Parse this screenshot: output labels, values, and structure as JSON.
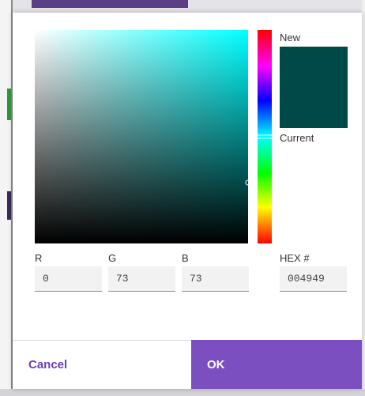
{
  "colors": {
    "selected": "#004949",
    "hue": "#00ffff",
    "primary": "#7b4fc0",
    "cancel_text": "#6a3db8"
  },
  "preview": {
    "new_label": "New",
    "current_label": "Current"
  },
  "picker": {
    "hue_fraction": 0.5,
    "saturation": 1.0,
    "brightness": 0.286
  },
  "fields": {
    "r_label": "R",
    "g_label": "G",
    "b_label": "B",
    "hex_label": "HEX #",
    "r_value": "0",
    "g_value": "73",
    "b_value": "73",
    "hex_value": "004949"
  },
  "buttons": {
    "cancel_label": "Cancel",
    "ok_label": "OK"
  }
}
